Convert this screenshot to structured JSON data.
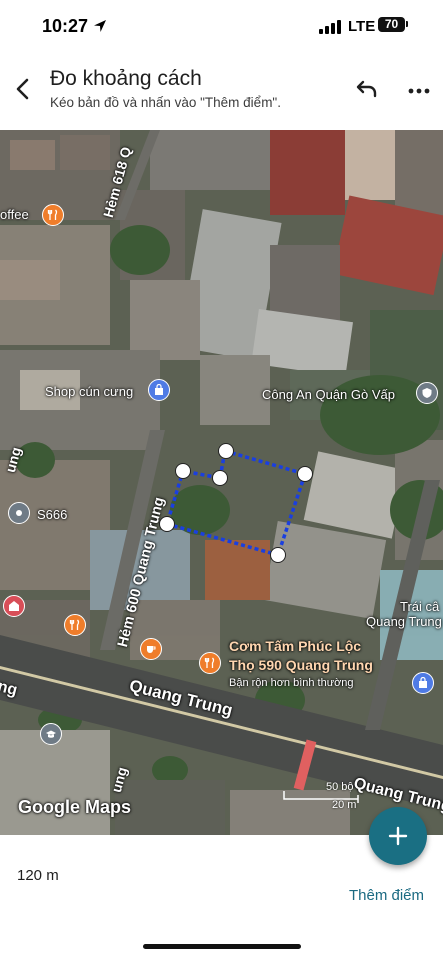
{
  "status_bar": {
    "time": "10:27",
    "network": "LTE",
    "battery": "70"
  },
  "header": {
    "title": "Đo khoảng cách",
    "subtitle": "Kéo bản đồ và nhấn vào \"Thêm điểm\"."
  },
  "map": {
    "roads": {
      "hem_618": "Hẻm 618 Q",
      "hem_600": "Hẻm 600 Quang Trung",
      "quang_trung_main": "Quang Trung",
      "quang_trung_right": "Quang Trung",
      "left_edge_road": "ng",
      "left_vertical": "ung",
      "bottom_vertical": "ung"
    },
    "places": {
      "coffee": "offee",
      "shop": "Shop cún cưng",
      "police": "Công An Quận Gò Vấp",
      "s666": "S666",
      "fruit": "Trái câ",
      "fruit_street": "Quang Trung",
      "restaurant_line1": "Cơm Tấm Phúc Lộc",
      "restaurant_line2": "Thọ 590 Quang Trung",
      "busy": "Bận rộn hơn bình thường"
    },
    "icons": {
      "coffee": "restaurant-icon",
      "shop": "shopping-bag-icon",
      "police": "police-icon",
      "s666": "location-pin-icon",
      "fruit": "shopping-bag-icon",
      "restaurant": "restaurant-icon",
      "cafe": "cafe-icon",
      "school": "graduation-cap-icon",
      "left_red": "store-icon",
      "left_food": "restaurant-icon"
    },
    "brand": "Google Maps",
    "scale": {
      "feet": "50 bộ",
      "meters": "20 m"
    },
    "measurement_color": "#1a3fe0"
  },
  "bottom": {
    "distance": "120 m",
    "add_point": "Thêm điểm"
  },
  "colors": {
    "accent": "#1b6a82",
    "fab": "#1a6f83"
  }
}
